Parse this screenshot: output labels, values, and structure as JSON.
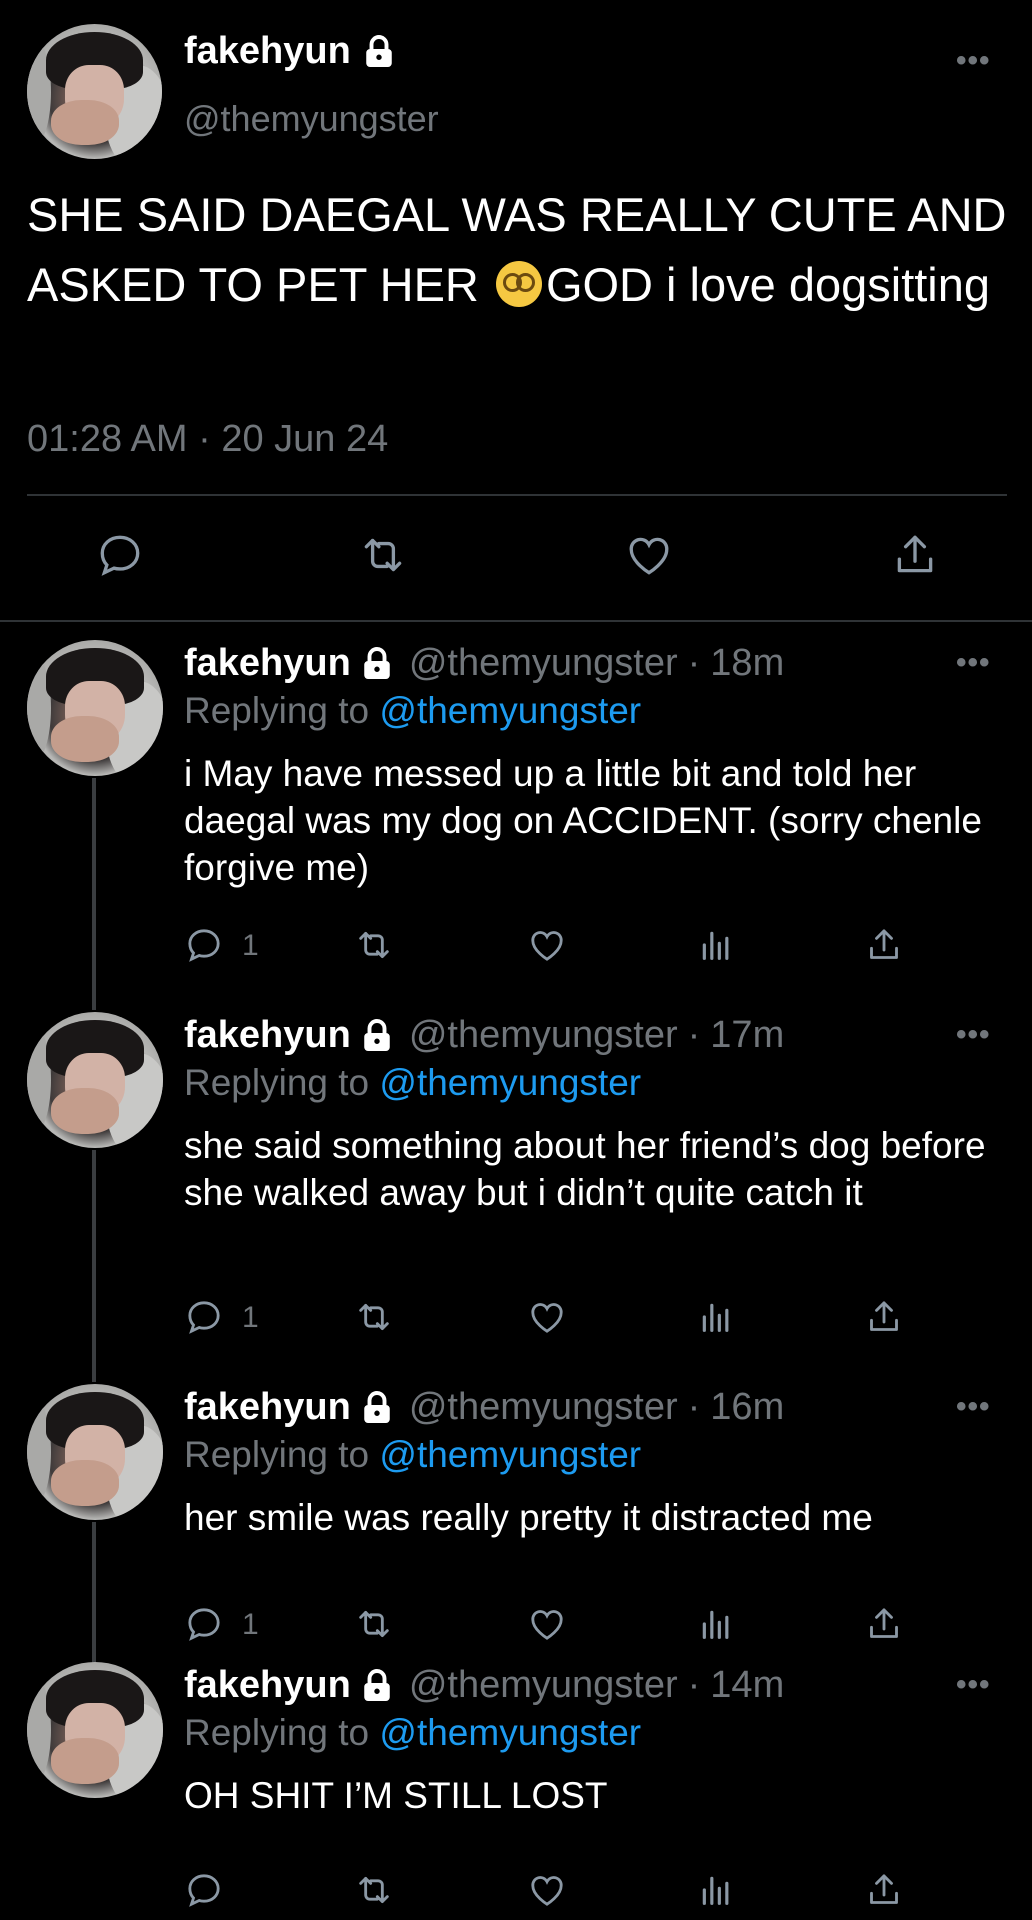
{
  "main_tweet": {
    "name": "fakehyun",
    "handle": "@themyungster",
    "text_part1": "SHE SAID DAEGAL WAS REALLY CUTE AND ASKED TO PET HER ",
    "emoji": "dizzy-face-emoji",
    "text_part2": "GOD i love dogsitting",
    "timestamp": "01:28 AM · 20 Jun 24",
    "more_label": "•••"
  },
  "reply_prefix": "Replying to",
  "separator": "·",
  "replies": [
    {
      "name": "fakehyun",
      "handle": "@themyungster",
      "time": "18m",
      "replying_to": "@themyungster",
      "text": "i May have messed up a little bit and told her daegal was my dog on ACCIDENT. (sorry chenle forgive me)",
      "reply_count": "1"
    },
    {
      "name": "fakehyun",
      "handle": "@themyungster",
      "time": "17m",
      "replying_to": "@themyungster",
      "text": "she said something about her friend’s dog before she walked away but i didn’t quite catch it",
      "reply_count": "1"
    },
    {
      "name": "fakehyun",
      "handle": "@themyungster",
      "time": "16m",
      "replying_to": "@themyungster",
      "text": "her smile was really pretty it distracted me",
      "reply_count": "1"
    },
    {
      "name": "fakehyun",
      "handle": "@themyungster",
      "time": "14m",
      "replying_to": "@themyungster",
      "text": "OH SHIT I’M STILL LOST",
      "reply_count": ""
    }
  ],
  "colors": {
    "background": "#000000",
    "text": "#ffffff",
    "secondary": "#71767b",
    "link": "#1d9bf0",
    "divider": "#2f3336"
  },
  "icons": [
    "comment-icon",
    "retweet-icon",
    "like-icon",
    "share-icon",
    "analytics-icon",
    "lock-icon",
    "more-icon"
  ]
}
